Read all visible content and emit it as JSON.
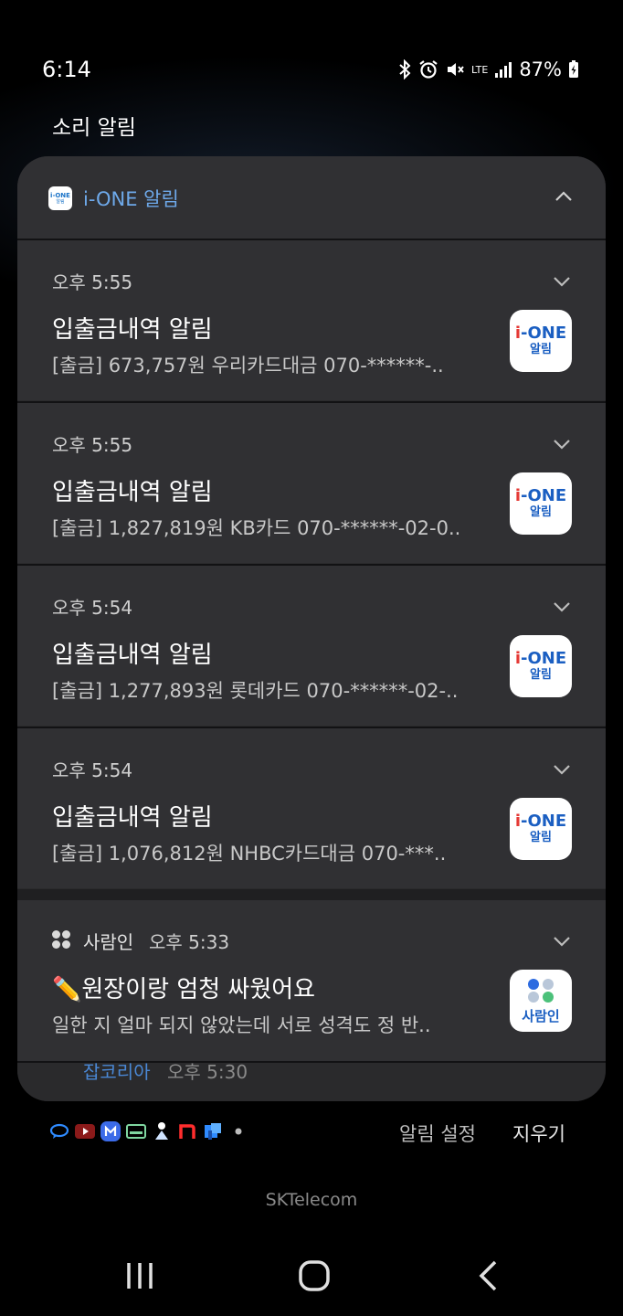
{
  "status_bar": {
    "time": "6:14",
    "network": "LTE",
    "battery": "87%"
  },
  "section_label": "소리 알림",
  "group": {
    "icon_line1": "i-ONE",
    "icon_line2": "알림",
    "title": "i-ONE 알림"
  },
  "notifications": [
    {
      "time": "오후 5:55",
      "title": "입출금내역 알림",
      "body": "[출금] 673,757원 우리카드대금 070-******-..",
      "icon_line1_a": "i",
      "icon_line1_b": "-ONE",
      "icon_line2": "알림"
    },
    {
      "time": "오후 5:55",
      "title": "입출금내역 알림",
      "body": "[출금] 1,827,819원 KB카드 070-******-02-0..",
      "icon_line1_a": "i",
      "icon_line1_b": "-ONE",
      "icon_line2": "알림"
    },
    {
      "time": "오후 5:54",
      "title": "입출금내역 알림",
      "body": "[출금] 1,277,893원 롯데카드 070-******-02-..",
      "icon_line1_a": "i",
      "icon_line1_b": "-ONE",
      "icon_line2": "알림"
    },
    {
      "time": "오후 5:54",
      "title": "입출금내역 알림",
      "body": "[출금] 1,076,812원 NHBC카드대금 070-***..",
      "icon_line1_a": "i",
      "icon_line1_b": "-ONE",
      "icon_line2": "알림"
    }
  ],
  "saramin": {
    "app": "사람인",
    "time": "오후 5:33",
    "title": "✏️원장이랑 엄청 싸웠어요",
    "body": "일한 지 얼마 되지 않았는데 서로 성격도 정 반..",
    "icon_text": "사람인"
  },
  "partial": {
    "app": "잡코리아",
    "time": "오후 5:30"
  },
  "footer": {
    "settings": "알림 설정",
    "clear": "지우기",
    "carrier": "SKTelecom"
  },
  "colors": {
    "accent": "#6ea9ea",
    "card": "#303033",
    "ione_blue": "#1b5fc2"
  }
}
